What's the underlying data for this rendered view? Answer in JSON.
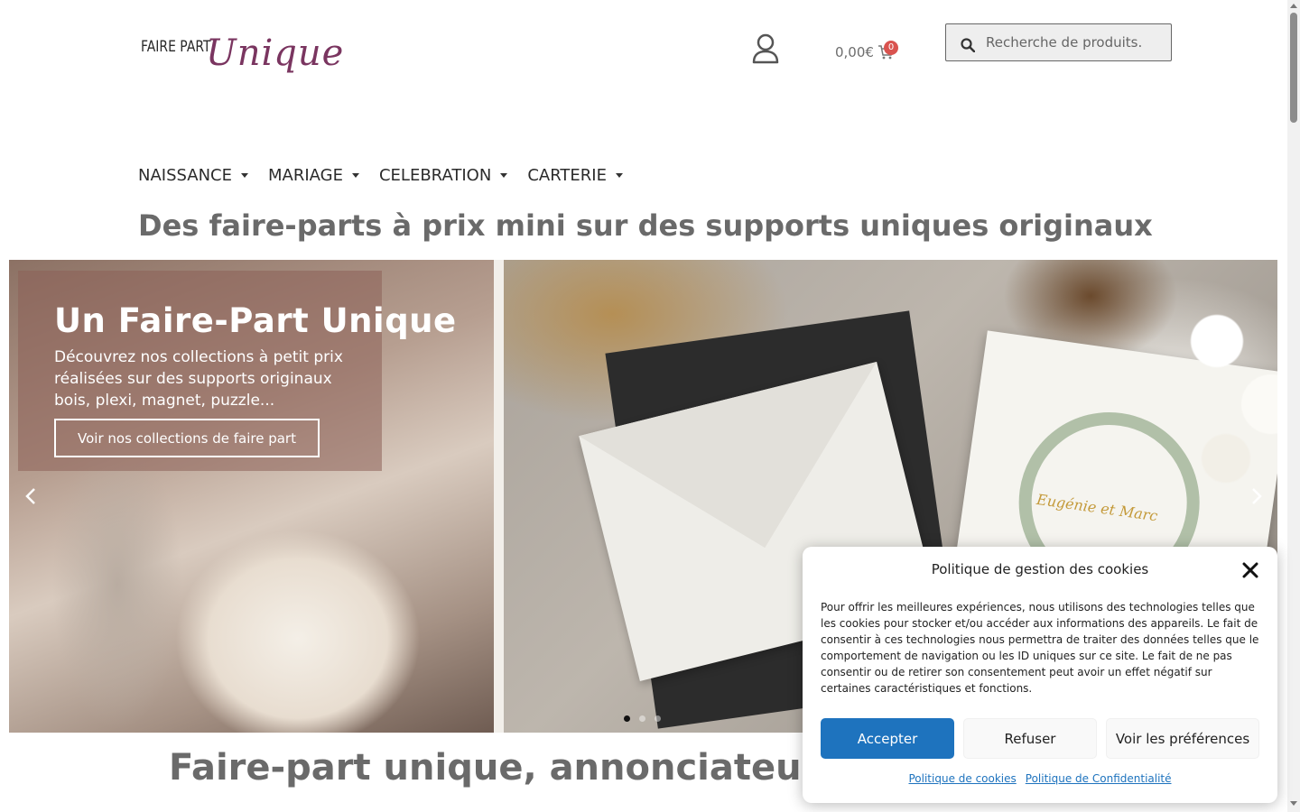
{
  "header": {
    "logo_small": "FAIRE PART",
    "logo_script": "Unique",
    "cart_total": "0,00€",
    "cart_count": "0",
    "search_placeholder": "Recherche de produits."
  },
  "nav": {
    "items": [
      {
        "label": "NAISSANCE"
      },
      {
        "label": "MARIAGE"
      },
      {
        "label": "CELEBRATION"
      },
      {
        "label": "CARTERIE"
      }
    ]
  },
  "tagline": "Des faire-parts à prix mini sur des supports uniques originaux",
  "hero": {
    "title": "Un Faire-Part Unique",
    "description_lines": [
      "Découvrez nos collections à petit prix",
      "réalisées sur des supports originaux",
      "bois, plexi, magnet, puzzle..."
    ],
    "cta_label": "Voir nos collections de faire part",
    "invite_names": "Eugénie et Marc",
    "slide_count": 3,
    "active_slide": 1
  },
  "section_title": "Faire-part unique, annonciateur de bo",
  "cookie": {
    "title": "Politique de gestion des cookies",
    "text": "Pour offrir les meilleures expériences, nous utilisons des technologies telles que les cookies pour stocker et/ou accéder aux informations des appareils. Le fait de consentir à ces technologies nous permettra de traiter des données telles que le comportement de navigation ou les ID uniques sur ce site. Le fait de ne pas consentir ou de retirer son consentement peut avoir un effet négatif sur certaines caractéristiques et fonctions.",
    "accept_label": "Accepter",
    "refuse_label": "Refuser",
    "prefs_label": "Voir les préférences",
    "link_cookies": "Politique de cookies",
    "link_privacy": "Politique de Confidentialité"
  },
  "colors": {
    "brand": "#7a3560",
    "accent_blue": "#1e73be",
    "badge": "#d9534f"
  },
  "icons": [
    "account-icon",
    "cart-icon",
    "search-icon",
    "chevron-left-icon",
    "chevron-right-icon",
    "close-icon"
  ]
}
